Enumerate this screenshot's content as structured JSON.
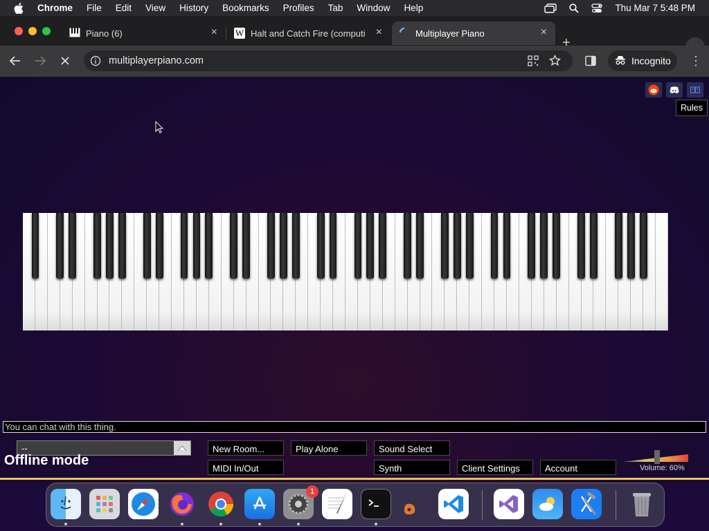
{
  "menubar": {
    "app_name": "Chrome",
    "items": [
      "File",
      "Edit",
      "View",
      "History",
      "Bookmarks",
      "Profiles",
      "Tab",
      "Window",
      "Help"
    ],
    "clock": "Thu Mar 7  5:48 PM",
    "icons": [
      "apple-icon",
      "screen-mirroring-icon",
      "spotlight-search-icon",
      "control-center-icon"
    ]
  },
  "tabs": [
    {
      "title": "Piano (6)",
      "favicon": "piano-icon",
      "active": false
    },
    {
      "title": "Halt and Catch Fire (computi",
      "favicon": "wikipedia-icon",
      "active": false
    },
    {
      "title": "Multiplayer Piano",
      "favicon": "loading-spinner-icon",
      "active": true
    }
  ],
  "toolbar": {
    "url": "multiplayerpiano.com",
    "profile_label": "Incognito"
  },
  "page": {
    "tooltip": "Rules",
    "chat_placeholder": "You can chat with this thing.",
    "room_select_value": "--",
    "status": "Offline mode",
    "buttons": {
      "new_room": "New Room...",
      "play_alone": "Play Alone",
      "sound_select": "Sound Select",
      "midi": "MIDI In/Out",
      "synth": "Synth",
      "client_settings": "Client Settings",
      "account": "Account"
    },
    "volume_label": "Volume: 60%",
    "volume_level": 0.6
  },
  "keyboard": {
    "white_keys": 52,
    "black_key_pattern": [
      1,
      0,
      1,
      1,
      0,
      1,
      1,
      1
    ]
  },
  "dock": {
    "apps": [
      "finder-icon",
      "launchpad-icon",
      "safari-icon",
      "firefox-icon",
      "chrome-icon",
      "app-store-icon",
      "system-settings-icon",
      "textedit-icon",
      "terminal-icon",
      "garageband-icon",
      "vscode-icon",
      "visual-studio-icon",
      "weather-icon",
      "xcode-icon",
      "trash-icon"
    ],
    "settings_badge": "1"
  },
  "colors": {
    "page_background": "#1c0a34",
    "accent_gold": "#e3c35a",
    "tooltip_bg": "#000000"
  }
}
